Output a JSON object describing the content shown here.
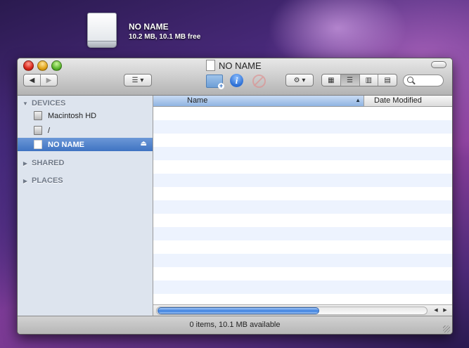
{
  "desktop": {
    "drive_name": "NO NAME",
    "drive_info": "10.2 MB, 10.1 MB free",
    "drive_icon": "removable-drive-icon"
  },
  "window": {
    "title": "NO NAME",
    "title_icon": "document-icon"
  },
  "toolbar": {
    "back_icon": "◀",
    "forward_icon": "▶",
    "arrange_icon": "☰ ▾",
    "gear_icon": "⚙ ▾",
    "info_glyph": "i",
    "new_folder_plus": "+",
    "view_modes": [
      "▦",
      "☰",
      "▥",
      "▤"
    ],
    "selected_view": 1
  },
  "sidebar": {
    "devices_label": "DEVICES",
    "shared_label": "SHARED",
    "places_label": "PLACES",
    "devices": [
      {
        "label": "Macintosh HD",
        "icon": "hard-drive-icon"
      },
      {
        "label": "/",
        "icon": "hard-drive-icon"
      },
      {
        "label": "NO NAME",
        "icon": "removable-drive-icon",
        "selected": true
      }
    ],
    "eject": "⏏",
    "expanded_tri": "▼",
    "collapsed_tri": "▶"
  },
  "list": {
    "columns": [
      "Name",
      "Date Modified"
    ],
    "sort_arrow": "▲",
    "empty_rows": 15
  },
  "scrollbar": {
    "left_arrow": "◀",
    "right_arrow": "▶"
  },
  "status": {
    "text": "0 items, 10.1 MB available"
  }
}
